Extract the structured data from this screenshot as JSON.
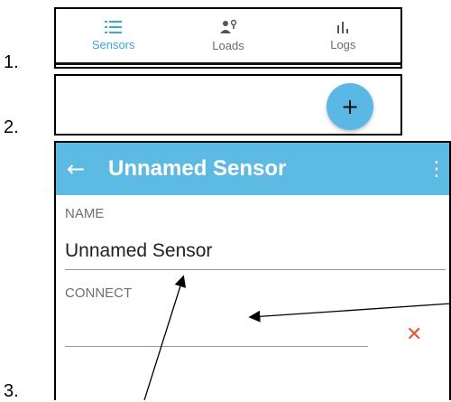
{
  "step_numbers": [
    "1.",
    "2.",
    "3."
  ],
  "bottom_nav": {
    "items": [
      {
        "label": "Sensors",
        "icon": "list-icon",
        "active": true
      },
      {
        "label": "Loads",
        "icon": "loads-icon",
        "active": false
      },
      {
        "label": "Logs",
        "icon": "bar-chart-icon",
        "active": false
      }
    ],
    "active_color": "#3ea7d6"
  },
  "fab": {
    "symbol": "+",
    "color": "#5bb8e4"
  },
  "edit_screen": {
    "app_bar": {
      "title": "Unnamed Sensor",
      "back_icon": "←",
      "menu_icon": "⋮",
      "color": "#5dbbe3"
    },
    "name_label": "NAME",
    "name_value": "Unnamed Sensor",
    "connect_label": "CONNECT",
    "connect_value": "",
    "clear_icon": "✕"
  }
}
